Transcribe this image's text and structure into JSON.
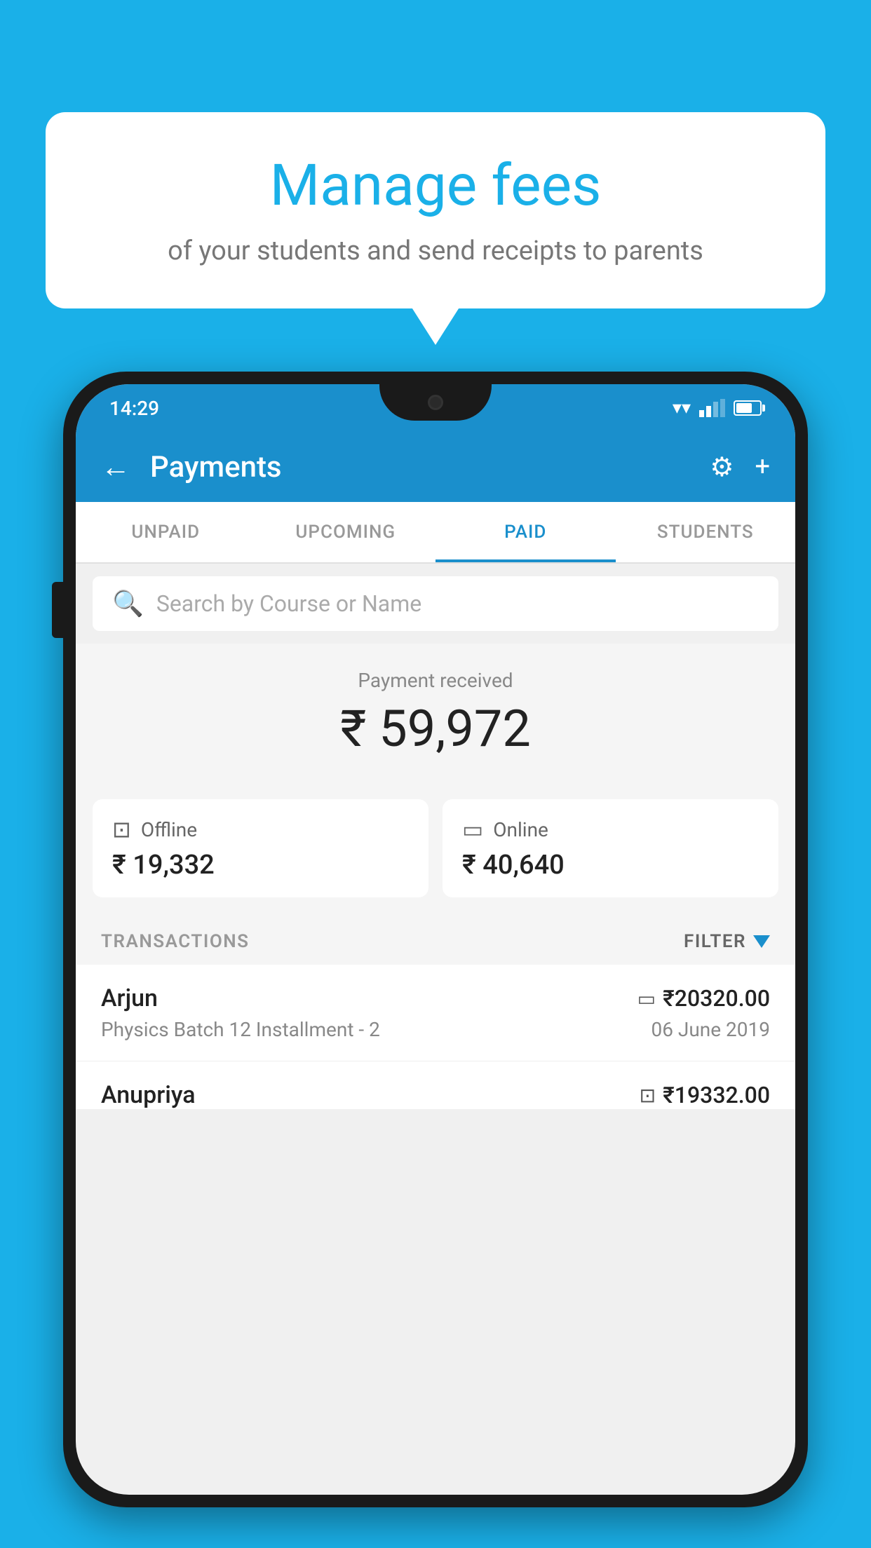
{
  "background_color": "#1ab0e8",
  "speech_bubble": {
    "title": "Manage fees",
    "subtitle": "of your students and send receipts to parents"
  },
  "status_bar": {
    "time": "14:29"
  },
  "app_bar": {
    "title": "Payments",
    "back_label": "←",
    "settings_label": "⚙",
    "add_label": "+"
  },
  "tabs": [
    {
      "label": "UNPAID",
      "active": false
    },
    {
      "label": "UPCOMING",
      "active": false
    },
    {
      "label": "PAID",
      "active": true
    },
    {
      "label": "STUDENTS",
      "active": false
    }
  ],
  "search": {
    "placeholder": "Search by Course or Name"
  },
  "payment_section": {
    "label": "Payment received",
    "amount": "₹ 59,972",
    "offline": {
      "label": "Offline",
      "amount": "₹ 19,332"
    },
    "online": {
      "label": "Online",
      "amount": "₹ 40,640"
    }
  },
  "transactions_section": {
    "label": "TRANSACTIONS",
    "filter_label": "FILTER"
  },
  "transactions": [
    {
      "name": "Arjun",
      "course": "Physics Batch 12 Installment - 2",
      "amount": "₹20320.00",
      "date": "06 June 2019",
      "payment_type": "card"
    },
    {
      "name": "Anupriya",
      "course": "",
      "amount": "₹19332.00",
      "date": "",
      "payment_type": "cash"
    }
  ]
}
